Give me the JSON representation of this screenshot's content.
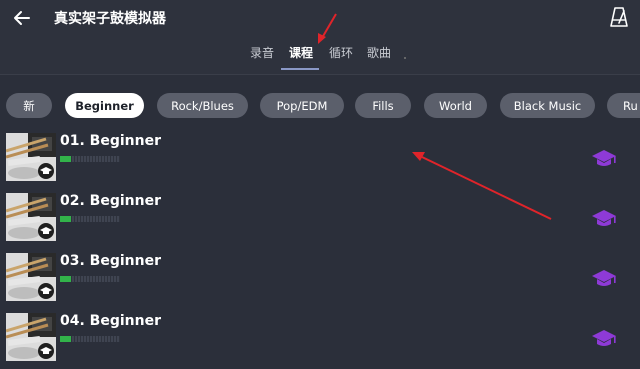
{
  "header": {
    "title": "真实架子鼓模拟器",
    "back_icon": "back-arrow-icon",
    "metronome_icon": "metronome-icon"
  },
  "tabs": [
    {
      "label": "录音",
      "active": false
    },
    {
      "label": "课程",
      "active": true
    },
    {
      "label": "循环",
      "active": false
    },
    {
      "label": "歌曲",
      "active": false
    }
  ],
  "chips": [
    {
      "label": "新",
      "active": false
    },
    {
      "label": "Beginner",
      "active": true
    },
    {
      "label": "Rock/Blues",
      "active": false
    },
    {
      "label": "Pop/EDM",
      "active": false
    },
    {
      "label": "Fills",
      "active": false
    },
    {
      "label": "World",
      "active": false
    },
    {
      "label": "Black Music",
      "active": false
    },
    {
      "label": "Ru",
      "active": false
    }
  ],
  "lessons": [
    {
      "title": "01. Beginner",
      "progress": 0.18
    },
    {
      "title": "02. Beginner",
      "progress": 0.18
    },
    {
      "title": "03. Beginner",
      "progress": 0.18
    },
    {
      "title": "04. Beginner",
      "progress": 0.18
    }
  ],
  "colors": {
    "background": "#2b2f3a",
    "chip": "#5b5f6b",
    "chip_active": "#ffffff",
    "progress": "#32b34a",
    "lesson_icon": "#8e3ad6",
    "annotation": "#e0242a"
  },
  "icons": {
    "lesson": "graduation-cap-icon",
    "thumbnail_badge": "graduation-cap-icon"
  }
}
